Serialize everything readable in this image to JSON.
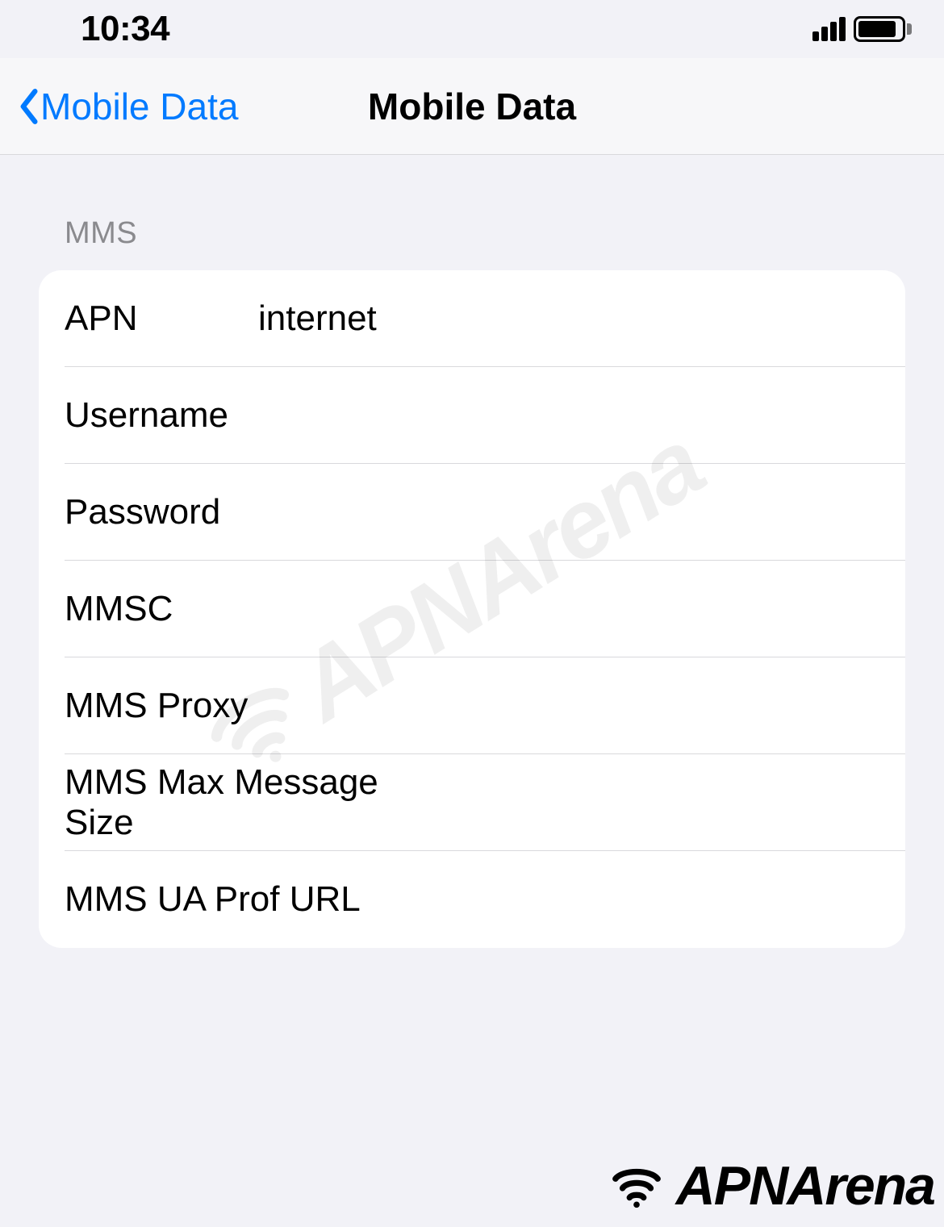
{
  "status_bar": {
    "time": "10:34"
  },
  "nav": {
    "back_label": "Mobile Data",
    "title": "Mobile Data"
  },
  "section": {
    "header": "MMS",
    "rows": [
      {
        "label": "APN",
        "value": "internet"
      },
      {
        "label": "Username",
        "value": ""
      },
      {
        "label": "Password",
        "value": ""
      },
      {
        "label": "MMSC",
        "value": ""
      },
      {
        "label": "MMS Proxy",
        "value": ""
      },
      {
        "label": "MMS Max Message Size",
        "value": ""
      },
      {
        "label": "MMS UA Prof URL",
        "value": ""
      }
    ]
  },
  "watermark_text": "APNArena",
  "logo_text": "APNArena"
}
